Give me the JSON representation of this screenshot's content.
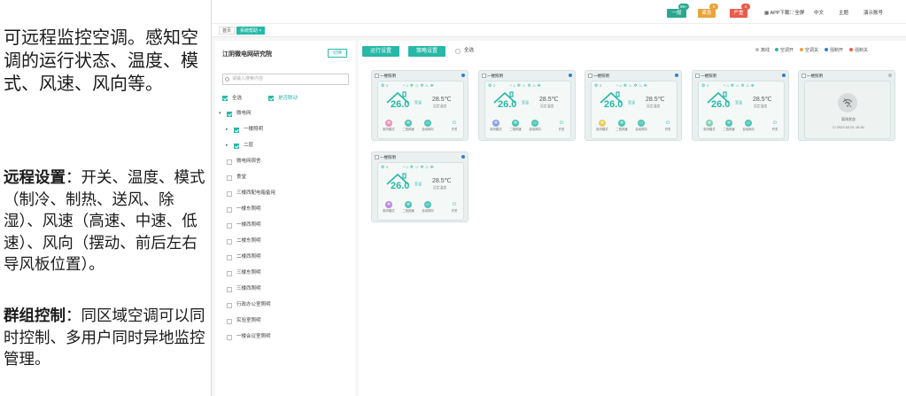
{
  "description": {
    "intro": "可远程监控空调。感知空调的运行状态、温度、模式、风速、风向等。",
    "remote_title": "远程设置",
    "remote_text": "：开关、温度、模式（制冷、制热、送风、除湿）、风速（高速、中速、低速）、风向（摆动、前后左右导风板位置）。",
    "group_title": "群组控制",
    "group_text": "：同区域空调可以同时控制、多用户同时异地监控管理。"
  },
  "topbar": {
    "badges": [
      {
        "label": "一般",
        "count": "99+",
        "color": "#2aa88f",
        "count_color": "#2aa88f"
      },
      {
        "label": "紧急",
        "count": "0",
        "color": "#e8a33a",
        "count_color": "#e8a33a"
      },
      {
        "label": "严重",
        "count": "0",
        "color": "#e85c4a",
        "count_color": "#e85c4a"
      }
    ],
    "tools": [
      "APP下载",
      "全屏",
      "中文",
      "主题",
      "演示账号"
    ]
  },
  "tabs": [
    {
      "label": "首页",
      "active": false
    },
    {
      "label": "系统帮助 ×",
      "active": true
    }
  ],
  "tree": {
    "org_name": "江阴微电网研究院",
    "switch_label": "切换",
    "search_placeholder": "请输入搜索内容",
    "select_all": "全选",
    "linkage": "是否联动",
    "nodes": [
      {
        "label": "微电网",
        "checked": true,
        "arrow": "▾",
        "indent": 0
      },
      {
        "label": "一楼照明",
        "checked": true,
        "arrow": "▸",
        "indent": 1
      },
      {
        "label": "二层",
        "checked": true,
        "arrow": "▸",
        "indent": 1
      },
      {
        "label": "微电网宿舍",
        "checked": false,
        "arrow": "",
        "indent": 0
      },
      {
        "label": "食堂",
        "checked": false,
        "arrow": "",
        "indent": 0
      },
      {
        "label": "三楼西配电箱备用",
        "checked": false,
        "arrow": "",
        "indent": 0
      },
      {
        "label": "一楼东照明",
        "checked": false,
        "arrow": "",
        "indent": 0
      },
      {
        "label": "一楼西照明",
        "checked": false,
        "arrow": "",
        "indent": 0
      },
      {
        "label": "二楼东照明",
        "checked": false,
        "arrow": "",
        "indent": 0
      },
      {
        "label": "二楼西照明",
        "checked": false,
        "arrow": "",
        "indent": 0
      },
      {
        "label": "三楼东照明",
        "checked": false,
        "arrow": "",
        "indent": 0
      },
      {
        "label": "三楼西照明",
        "checked": false,
        "arrow": "",
        "indent": 0
      },
      {
        "label": "行政办公室照明",
        "checked": false,
        "arrow": "",
        "indent": 0
      },
      {
        "label": "实验室照明",
        "checked": false,
        "arrow": "",
        "indent": 0
      },
      {
        "label": "一楼会议室照明",
        "checked": false,
        "arrow": "",
        "indent": 0
      }
    ]
  },
  "main": {
    "run_settings": "运行设置",
    "strategy_settings": "策略设置",
    "select_all": "全选",
    "legend": [
      {
        "label": "离线",
        "color": "#bbbbbb"
      },
      {
        "label": "空调开",
        "color": "#27b8a8"
      },
      {
        "label": "空调关",
        "color": "#e8a33a"
      },
      {
        "label": "强制开",
        "color": "#2b7fd6"
      },
      {
        "label": "强制关",
        "color": "#e85c4a"
      }
    ],
    "cards": [
      {
        "title": "一楼照明",
        "temp": "26.0",
        "unit": "室温",
        "set_temp": "28.5℃",
        "set_label": "设定温度",
        "mode_color": "#e87aa8"
      },
      {
        "title": "一楼照明",
        "temp": "26.0",
        "unit": "室温",
        "set_temp": "28.5℃",
        "set_label": "设定温度",
        "mode_color": "#6c8de8"
      },
      {
        "title": "一楼照明",
        "temp": "26.0",
        "unit": "室温",
        "set_temp": "28.5℃",
        "set_label": "设定温度",
        "mode_color": "#e8c23a"
      },
      {
        "title": "一楼照明",
        "temp": "26.0",
        "unit": "室温",
        "set_temp": "28.5℃",
        "set_label": "设定温度",
        "mode_color": "#6cc4a8"
      },
      {
        "title": "一楼照明",
        "temp": "26.0",
        "unit": "室温",
        "set_temp": "28.5℃",
        "set_label": "设定温度",
        "mode_color": "#b06ce8"
      }
    ],
    "controls": [
      "制冷模式",
      "二档风速",
      "自动风向",
      "开关"
    ],
    "offline_card": {
      "title": "一楼照明",
      "status": "离线状态",
      "time": "2023.02.01  16:30"
    }
  }
}
